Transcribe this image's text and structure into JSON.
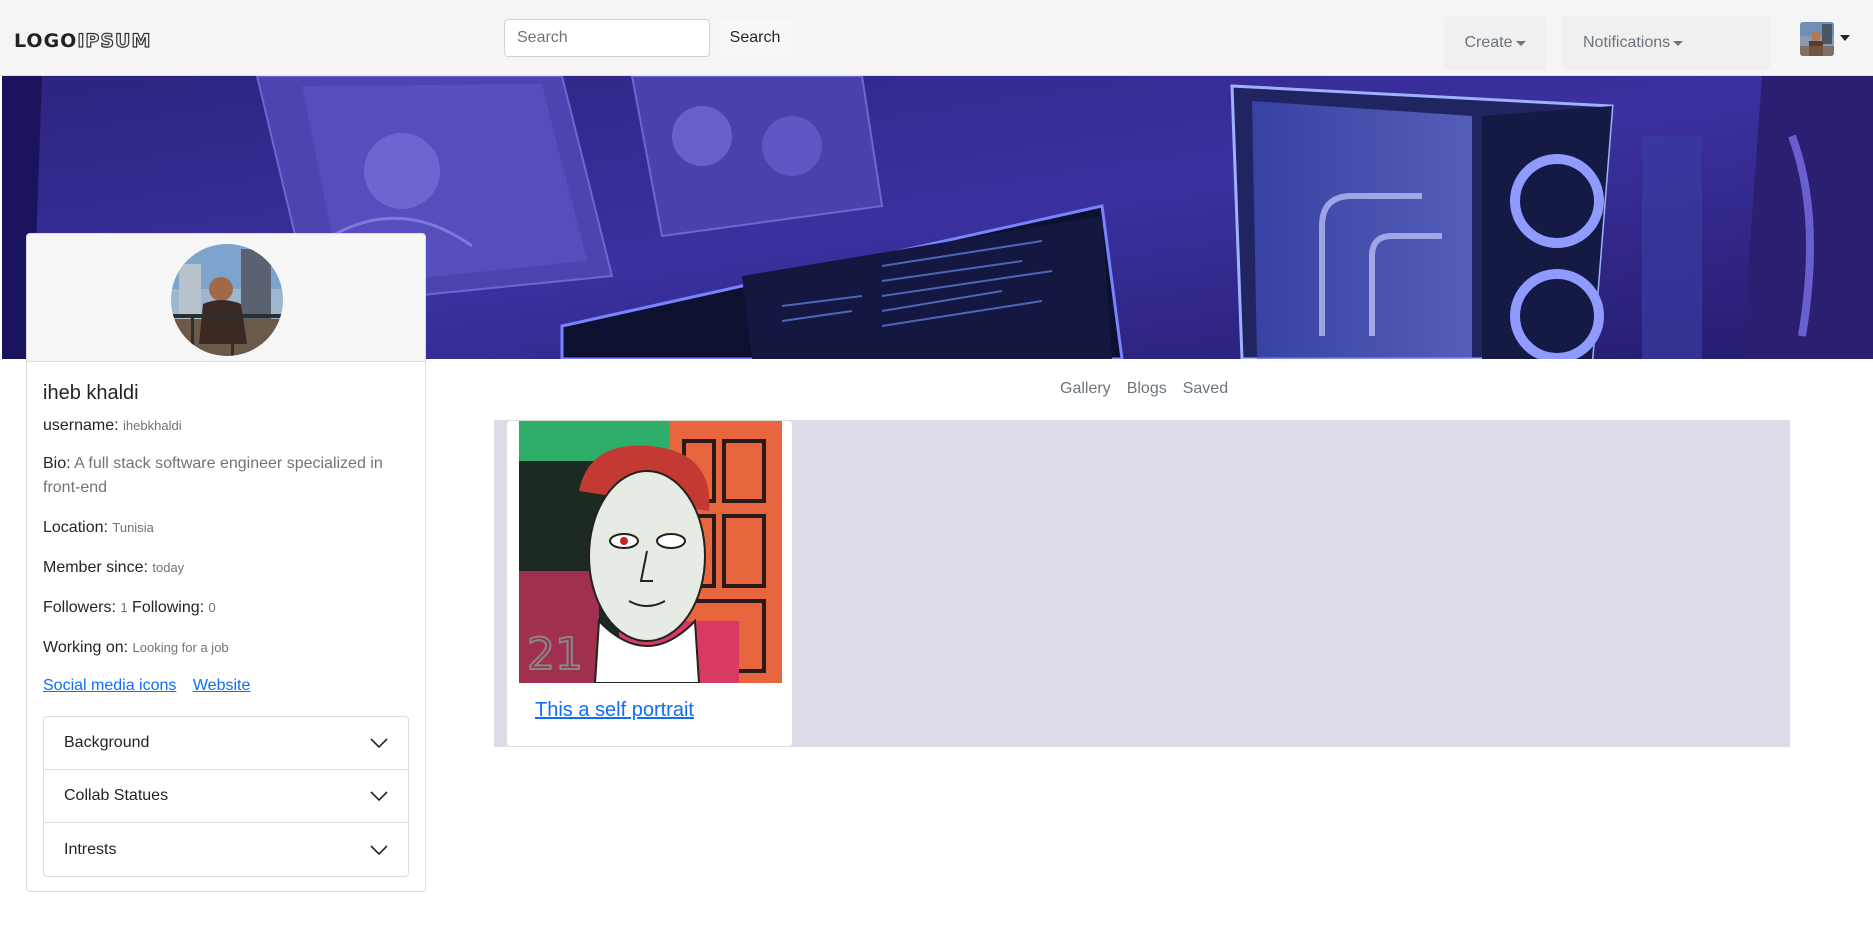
{
  "navbar": {
    "logo_part1": "LOGO",
    "logo_part2": "IPSUM",
    "search_placeholder": "Search",
    "search_button": "Search",
    "create_label": "Create",
    "notifications_label": "Notifications"
  },
  "profile": {
    "name": "iheb khaldi",
    "username_label": "username:",
    "username_value": "ihebkhaldi",
    "bio_label": "Bio:",
    "bio_value": "A full stack software engineer specialized in front-end",
    "location_label": "Location:",
    "location_value": "Tunisia",
    "member_label": "Member since:",
    "member_value": "today",
    "followers_label": "Followers:",
    "followers_value": "1",
    "following_label": "Following:",
    "following_value": "0",
    "working_label": "Working on:",
    "working_value": "Looking for a job",
    "links": [
      "Social media icons",
      "Website"
    ]
  },
  "accordion": [
    "Background",
    "Collab Statues",
    "Intrests"
  ],
  "tabs": [
    "Gallery",
    "Blogs",
    "Saved"
  ],
  "gallery": {
    "posts": [
      {
        "title": "This a self portrait",
        "image_badge": "21"
      }
    ]
  },
  "colors": {
    "accent": "#0d6efd",
    "gallery_bg": "#dedbe8",
    "banner": "#2b2278"
  }
}
